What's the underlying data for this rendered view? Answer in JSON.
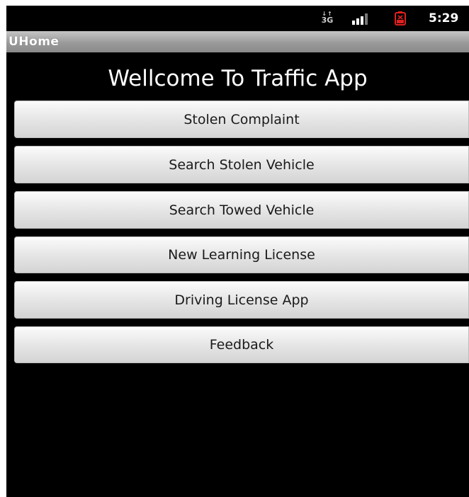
{
  "status_bar": {
    "network_label": "3G",
    "network_arrows": "↓↑",
    "signal_icon": "signal-bars-icon",
    "battery_icon": "battery-alert-icon",
    "battery_color": "#e02020",
    "time": "5:29"
  },
  "title_bar": {
    "title": "UHome"
  },
  "main": {
    "welcome": "Wellcome To Traffic App",
    "buttons": [
      {
        "label": "Stolen Complaint"
      },
      {
        "label": "Search Stolen Vehicle"
      },
      {
        "label": "Search Towed Vehicle"
      },
      {
        "label": "New Learning License"
      },
      {
        "label": "Driving License App"
      },
      {
        "label": "Feedback"
      }
    ]
  }
}
